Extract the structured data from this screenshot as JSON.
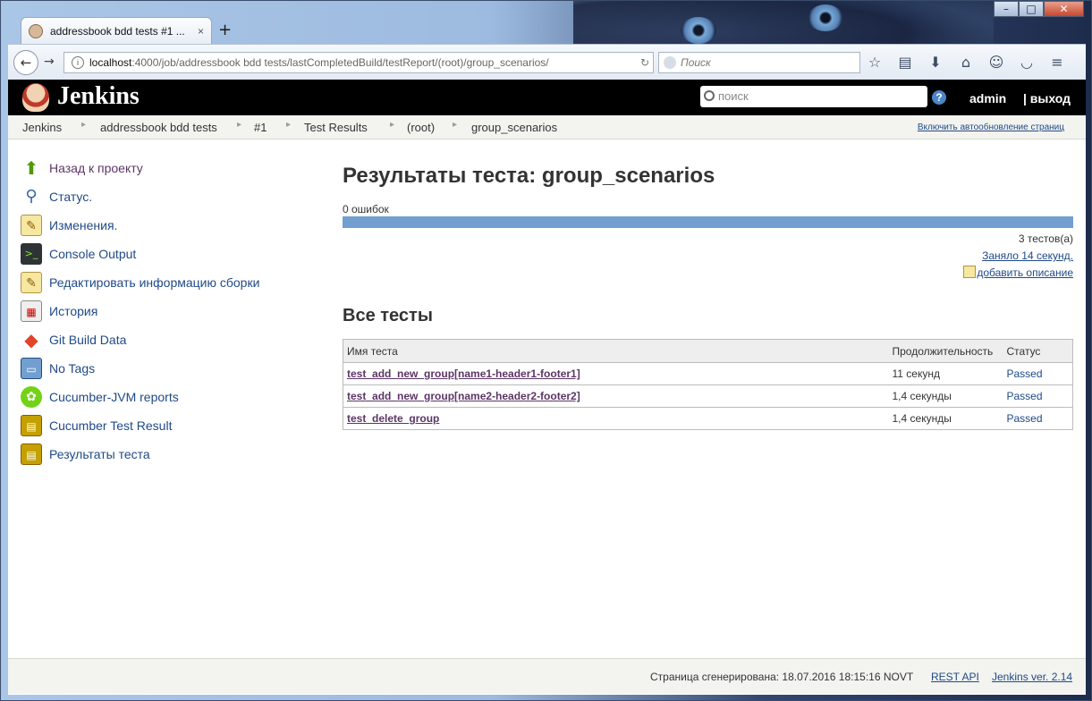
{
  "browser": {
    "tab_title": "addressbook bdd tests #1 ...",
    "tab_close": "×",
    "new_tab": "+",
    "url_host": "localhost",
    "url_rest": ":4000/job/addressbook bdd tests/lastCompletedBuild/testReport/(root)/group_scenarios/",
    "search_placeholder": "Поиск"
  },
  "header": {
    "brand": "Jenkins",
    "search_placeholder": "поиск",
    "help": "?",
    "user": "admin",
    "logout": "| выход"
  },
  "breadcrumbs": {
    "items": [
      "Jenkins",
      "addressbook bdd tests",
      "#1",
      "Test Results",
      "(root)",
      "group_scenarios"
    ],
    "autorefresh": "Включить автообновление страниц"
  },
  "sidebar": {
    "items": [
      {
        "label": "Назад к проекту",
        "icon": "up-arrow-icon"
      },
      {
        "label": "Статус.",
        "icon": "magnifier-icon"
      },
      {
        "label": "Изменения.",
        "icon": "notepad-icon"
      },
      {
        "label": "Console Output",
        "icon": "terminal-icon"
      },
      {
        "label": "Редактировать информацию сборки",
        "icon": "notepad-icon"
      },
      {
        "label": "История",
        "icon": "history-icon"
      },
      {
        "label": "Git Build Data",
        "icon": "git-icon"
      },
      {
        "label": "No Tags",
        "icon": "save-disk-icon"
      },
      {
        "label": "Cucumber-JVM reports",
        "icon": "cucumber-icon"
      },
      {
        "label": "Cucumber Test Result",
        "icon": "clipboard-icon"
      },
      {
        "label": "Результаты теста",
        "icon": "clipboard-icon"
      }
    ]
  },
  "main": {
    "title": "Результаты теста: group_scenarios",
    "failures": "0 ошибок",
    "pass_fraction": 1.0,
    "test_count": "3 тестов(а)",
    "duration": "Заняло 14 секунд.",
    "add_description": "добавить описание",
    "all_tests_heading": "Все тесты",
    "columns": [
      "Имя теста",
      "Продолжительность",
      "Статус"
    ],
    "rows": [
      {
        "name": "test_add_new_group[name1-header1-footer1]",
        "duration": "11 секунд",
        "status": "Passed"
      },
      {
        "name": "test_add_new_group[name2-header2-footer2]",
        "duration": "1,4 секунды",
        "status": "Passed"
      },
      {
        "name": "test_delete_group",
        "duration": "1,4 секунды",
        "status": "Passed"
      }
    ]
  },
  "footer": {
    "generated": "Страница сгенерирована: 18.07.2016 18:15:16 NOVT",
    "rest_api": "REST API",
    "version": "Jenkins ver. 2.14"
  }
}
